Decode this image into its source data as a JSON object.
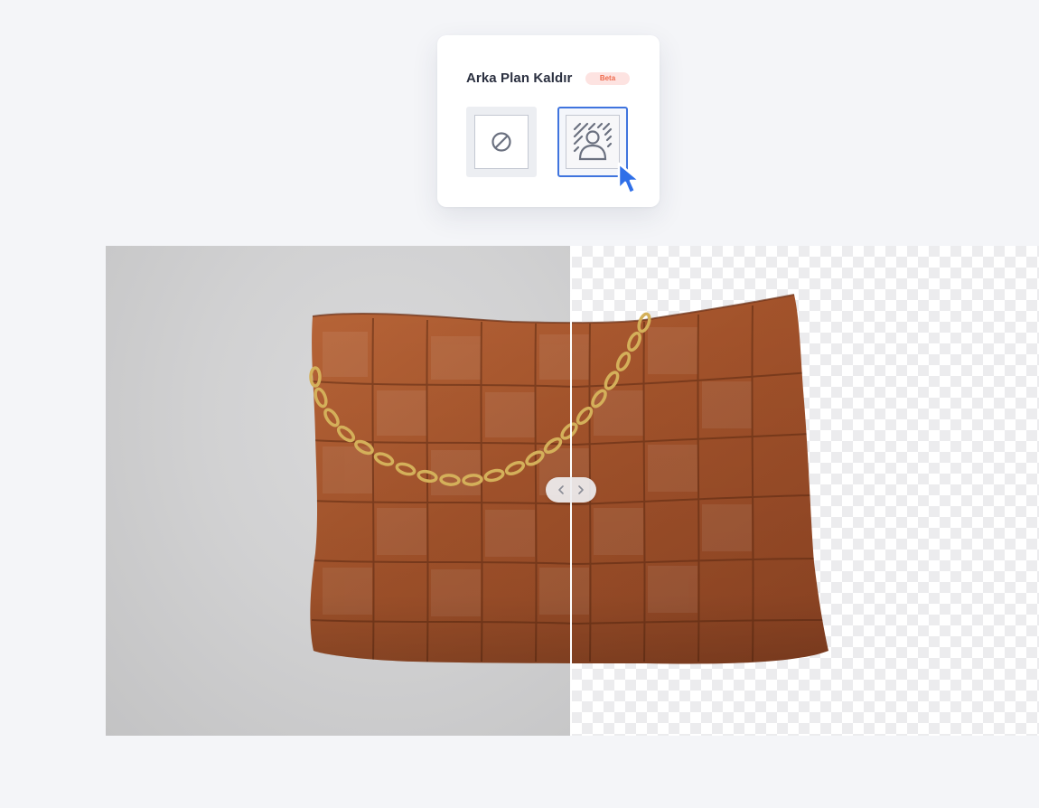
{
  "panel": {
    "title": "Arka Plan Kaldır",
    "badge": "Beta",
    "options": [
      {
        "id": "none",
        "icon": "no-symbol-icon",
        "selected": false
      },
      {
        "id": "remove-background",
        "icon": "person-remove-background-icon",
        "selected": true
      }
    ]
  },
  "compare": {
    "before_label": "original",
    "after_label": "background-removed",
    "handle_icons": [
      "chevron-left-icon",
      "chevron-right-icon"
    ]
  },
  "colors": {
    "page_background": "#f4f5f8",
    "accent": "#3f74de",
    "badge_background": "#fde3e1",
    "badge_text": "#ef6a4c",
    "leather": "#a2522a"
  }
}
